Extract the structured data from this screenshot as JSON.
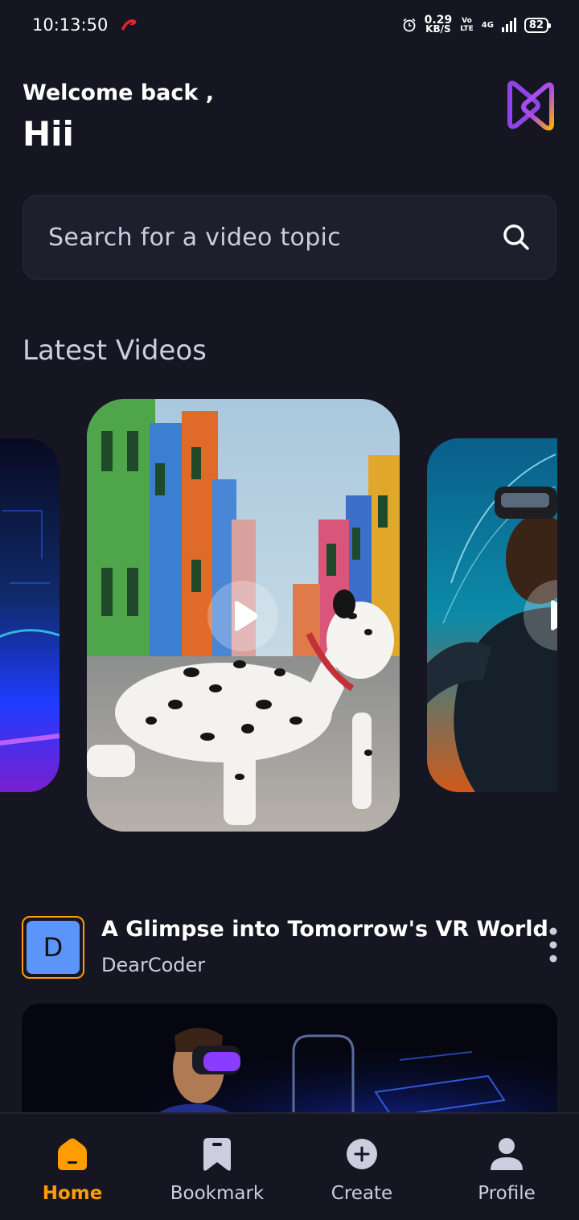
{
  "status_bar": {
    "time": "10:13:50",
    "net_speed_value": "0.29",
    "net_speed_unit": "KB/S",
    "volte_top": "Vo",
    "volte_bottom": "LTE",
    "network": "4G",
    "battery": "82"
  },
  "header": {
    "welcome": "Welcome back ,",
    "username": "Hii"
  },
  "search": {
    "placeholder": "Search for a video topic"
  },
  "latest": {
    "title": "Latest Videos"
  },
  "video": {
    "avatar_letter": "D",
    "title": "A Glimpse into Tomorrow's VR World",
    "creator": "DearCoder"
  },
  "tabs": [
    {
      "label": "Home",
      "icon": "home-icon",
      "active": true
    },
    {
      "label": "Bookmark",
      "icon": "bookmark-icon",
      "active": false
    },
    {
      "label": "Create",
      "icon": "plus-circle-icon",
      "active": false
    },
    {
      "label": "Profile",
      "icon": "profile-icon",
      "active": false
    }
  ],
  "colors": {
    "background": "#161622",
    "accent": "#ff9c01",
    "field": "#1e1e2d",
    "muted_text": "#cdcde0",
    "avatar": "#5b95f9"
  }
}
